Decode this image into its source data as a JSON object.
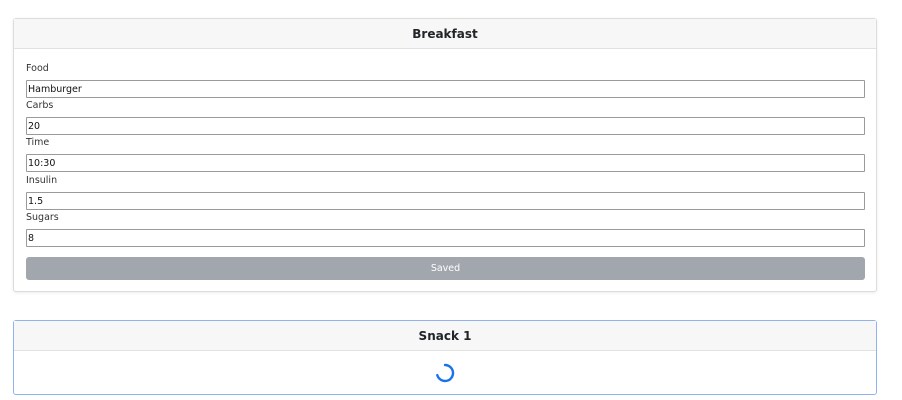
{
  "breakfast": {
    "title": "Breakfast",
    "fields": [
      {
        "label": "Food",
        "value": "Hamburger"
      },
      {
        "label": "Carbs",
        "value": "20"
      },
      {
        "label": "Time",
        "value": "10:30"
      },
      {
        "label": "Insulin",
        "value": "1.5"
      },
      {
        "label": "Sugars",
        "value": "8"
      }
    ],
    "button_label": "Saved"
  },
  "snack1": {
    "title": "Snack 1",
    "spinner_color": "#1a73e8"
  },
  "colors": {
    "button_disabled": "#a2a7ae",
    "header_bg": "#f7f7f7",
    "active_border": "#8fb3ea"
  },
  "icons": {
    "loading": "loading-spinner-icon"
  }
}
